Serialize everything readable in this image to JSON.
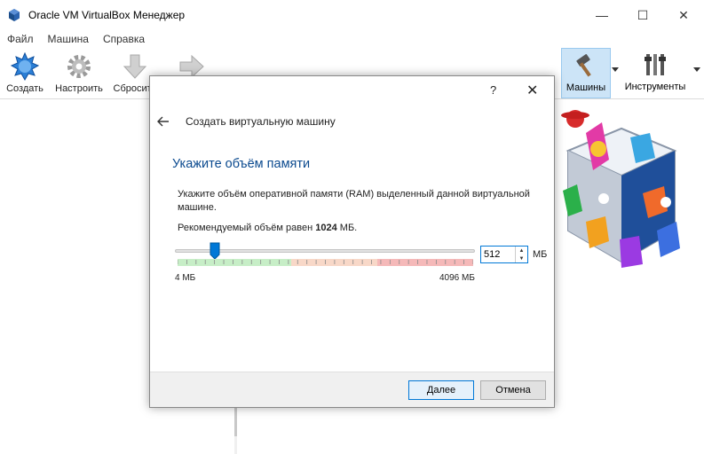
{
  "window": {
    "title": "Oracle VM VirtualBox Менеджер",
    "minimize": "—",
    "maximize": "☐",
    "close": "✕"
  },
  "menu": [
    "Файл",
    "Машина",
    "Справка"
  ],
  "toolbar": {
    "create": "Создать",
    "settings": "Настроить",
    "discard": "Сбросить",
    "machines": "Машины",
    "tools": "Инструменты"
  },
  "dialog": {
    "help": "?",
    "close": "✕",
    "heading": "Создать виртуальную машину",
    "page_title": "Укажите объём памяти",
    "description": "Укажите объём оперативной памяти (RAM) выделенный данной виртуальной машине.",
    "recommend_prefix": "Рекомендуемый объём равен ",
    "recommend_value": "1024",
    "recommend_suffix": " МБ.",
    "memory_value": "512",
    "memory_fraction": 0.125,
    "unit": "МБ",
    "min_label": "4 МБ",
    "max_label": "4096 МБ",
    "next": "Далее",
    "cancel": "Отмена"
  },
  "colors": {
    "accent": "#0078d7",
    "title_blue": "#0b4a8f",
    "active_tool": "#cce4f7"
  }
}
